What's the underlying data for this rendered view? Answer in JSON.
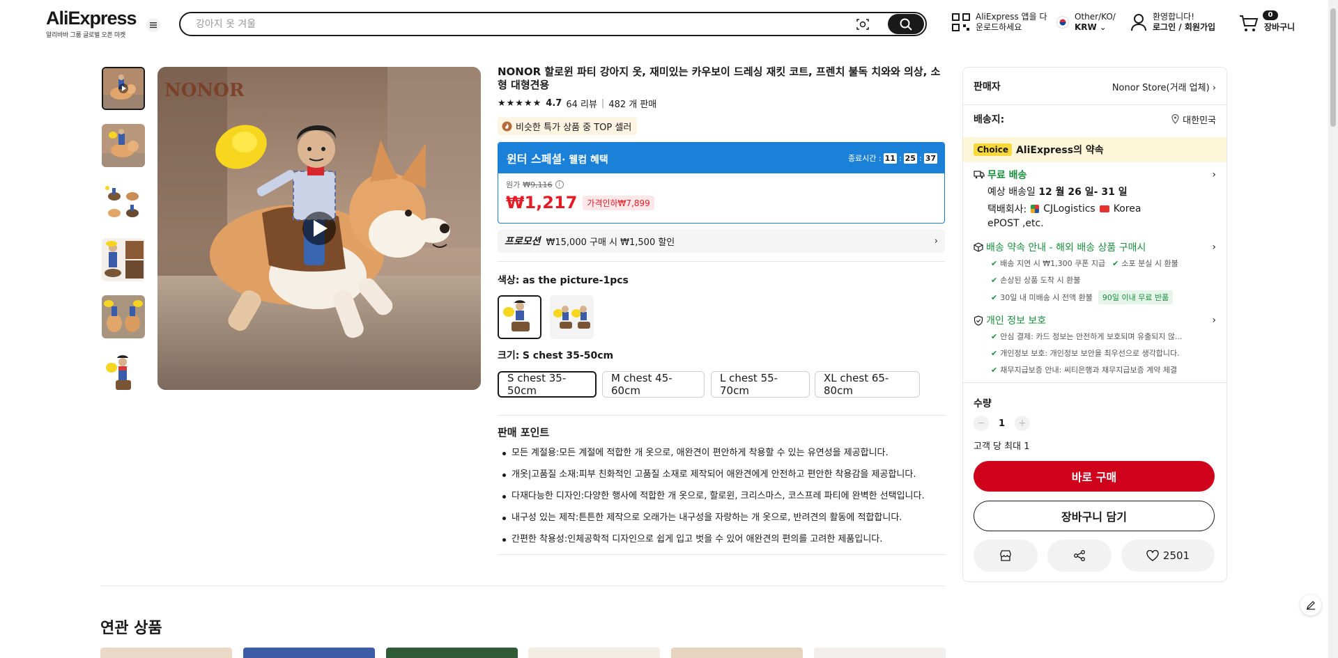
{
  "header": {
    "logo": "AliExpress",
    "logo_sub": "알리바바 그룹 글로벌 오픈 마켓",
    "search_placeholder": "강아지 옷 겨울",
    "app_line1": "AliExpress 앱을 다",
    "app_line2": "운로드하세요",
    "locale_line1": "Other/KO/",
    "locale_line2": "KRW",
    "account_line1": "환영합니다!",
    "account_line2": "로그인 / 회원가입",
    "cart_count": "0",
    "cart_label": "장바구니"
  },
  "product": {
    "title": "NONOR 할로윈 파티 강아지 옷, 재미있는 카우보이 드레싱 재킷 코트, 프렌치 불독 치와와 의상, 소형 대형견용",
    "watermark": "NONOR",
    "rating": "4.7",
    "reviews": "64 리뷰",
    "sold": "482 개 판매",
    "stars": 4.7,
    "top_seller": "비슷한 특가 상품 중 TOP 셀러",
    "deal_title": "윈터 스페셜",
    "deal_sub": "· 웰컴 혜택",
    "timer_label": "종료시간 :",
    "timer": [
      "11",
      "25",
      "37"
    ],
    "orig_label": "원가",
    "orig_price": "₩9,116",
    "price": "₩1,217",
    "discount": "가격인하₩7,899",
    "promo_label": "프로모션",
    "promo_text": "₩15,000 구매 시 ₩1,500 할인",
    "color_label": "색상:",
    "color_value": "as the picture-1pcs",
    "size_label": "크기:",
    "size_value": "S chest 35-50cm",
    "sizes": [
      "S chest 35-50cm",
      "M chest 45-60cm",
      "L chest 55-70cm",
      "XL chest 65-80cm"
    ],
    "points_title": "판매 포인트",
    "points": [
      "모든 계절용:모든 계절에 적합한 개 옷으로, 애완견이 편안하게 착용할 수 있는 유연성을 제공합니다.",
      "개옷|고품질 소재:피부 친화적인 고품질 소재로 제작되어 애완견에게 안전하고 편안한 착용감을 제공합니다.",
      "다재다능한 디자인:다양한 행사에 적합한 개 옷으로, 할로윈, 크리스마스, 코스프레 파티에 완벽한 선택입니다.",
      "내구성 있는 제작:튼튼한 제작으로 오래가는 내구성을 자랑하는 개 옷으로, 반려견의 활동에 적합합니다.",
      "간편한 착용성:인체공학적 디자인으로 쉽게 입고 벗을 수 있어 애완견의 편의를 고려한 제품입니다."
    ]
  },
  "panel": {
    "seller_label": "판매자",
    "seller_value": "Nonor Store(거래 업체)",
    "ship_label": "배송지:",
    "ship_value": "대한민국",
    "choice_tag": "Choice",
    "choice_text": "AliExpress의 약속",
    "free_ship": "무료 배송",
    "eta_prefix": "예상 배송일",
    "eta_value": "12 월 26 일- 31 일",
    "carrier_label": "택배회사:",
    "carrier1": "CJLogistics",
    "carrier2": "Korea",
    "carrier3": "ePOST ,etc.",
    "promise_title": "배송 약속 안내 - 해외 배송 상품 구매시",
    "promise_items": [
      "배송 지연 시 ₩1,300 쿠폰 지급",
      "소포 분실 시 환불",
      "손상된 상품 도착 시 환불",
      "30일 내 미배송 시 전액 환불"
    ],
    "return_tag": "90일 이내 무료 반품",
    "privacy_title": "개인 정보 보호",
    "privacy_items": [
      "안심 결제: 카드 정보는 안전하게 보호되며 유출되지 않...",
      "개인정보 보호: 개인정보 보안을 최우선으로 생각합니다.",
      "채무지급보증 안내: 씨티은행과 채무지급보증 계약 체결"
    ],
    "qty_label": "수량",
    "qty_value": "1",
    "limit": "고객 당 최대 1",
    "buy_now": "바로 구매",
    "add_cart": "장바구니 담기",
    "wish_count": "2501"
  },
  "related": {
    "title": "연관 상품"
  },
  "colors": {
    "brand_red": "#d0011b",
    "price_red": "#e51b23",
    "deal_blue": "#1b80d8",
    "green": "#1a8f3c",
    "choice_yellow": "#f8d83a"
  }
}
